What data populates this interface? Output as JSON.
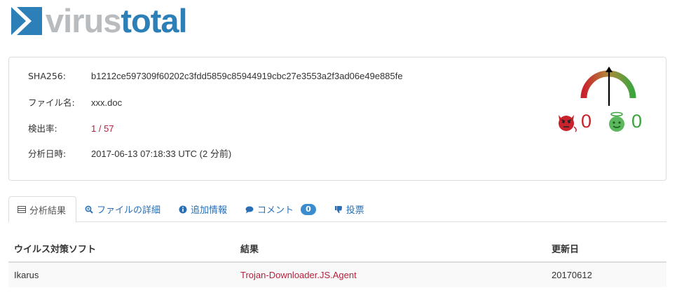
{
  "logo": {
    "part1": "virus",
    "part2": "total",
    "mark_icon": "virustotal-logo-icon"
  },
  "summary": {
    "sha256_label": "SHA256:",
    "sha256_value": "b1212ce597309f60202c3fdd5859c85944919cbc27e3553a2f3ad06e49e885fe",
    "filename_label": "ファイル名:",
    "filename_value": "xxx.doc",
    "detection_label": "検出率:",
    "detection_value": "1 / 57",
    "date_label": "分析日時:",
    "date_value": "2017-06-13 07:18:33 UTC (2 分前)"
  },
  "score": {
    "bad_icon": "devil-icon",
    "bad_value": "0",
    "good_icon": "angel-icon",
    "good_value": "0"
  },
  "tabs": [
    {
      "label": "分析結果",
      "icon": "table-icon",
      "active": true
    },
    {
      "label": "ファイルの詳細",
      "icon": "zoom-icon"
    },
    {
      "label": "追加情報",
      "icon": "info-icon"
    },
    {
      "label": "コメント",
      "icon": "comment-icon",
      "badge": "0"
    },
    {
      "label": "投票",
      "icon": "thumbs-down-icon"
    }
  ],
  "table": {
    "headers": [
      "ウイルス対策ソフト",
      "結果",
      "更新日"
    ],
    "rows": [
      [
        "Ikarus",
        "Trojan-Downloader.JS.Agent",
        "20170612"
      ]
    ]
  },
  "colors": {
    "brand_blue": "#2d7fb8",
    "brand_gray": "#b9bcbf",
    "link": "#2a6fb5",
    "malicious": "#b4213d",
    "bad_score": "#c8232c",
    "good_score": "#3ca43f"
  }
}
